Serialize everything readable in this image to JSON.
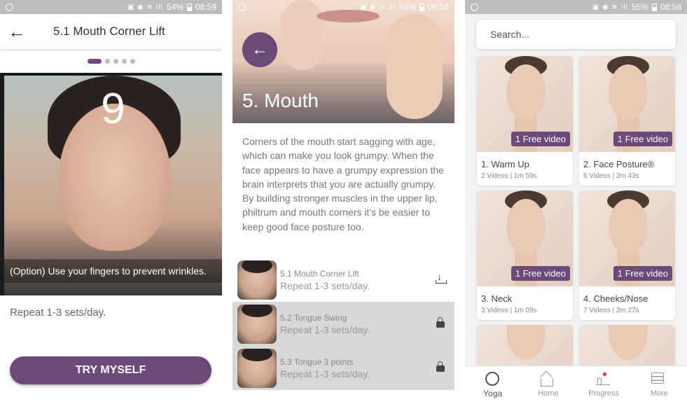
{
  "status_bars": [
    {
      "battery": "54%",
      "time": "08:59"
    },
    {
      "battery": "55%",
      "time": "08:58"
    },
    {
      "battery": "55%",
      "time": "08:58"
    }
  ],
  "screen1": {
    "title": "5.1 Mouth Corner Lift",
    "page_count": 5,
    "active_page": 1,
    "counter": "9",
    "caption": "(Option) Use your fingers to prevent wrinkles.",
    "repeat": "Repeat 1-3 sets/day.",
    "button": "TRY MYSELF"
  },
  "screen2": {
    "title": "5. Mouth",
    "description": "Corners of the mouth start sagging with age, which can make you look grumpy. When the face appears to have a grumpy expression the brain interprets that you are actually grumpy. By building stronger muscles in the upper lip, philtrum and mouth corners it's be easier to keep good face posture too.",
    "exercises": [
      {
        "name": "5.1 Mouth Corner Lift",
        "sub": "Repeat 1-3 sets/day.",
        "icon": "download-icon",
        "locked": false
      },
      {
        "name": "5.2 Tongue Swing",
        "sub": "Repeat 1-3 sets/day.",
        "icon": "lock-icon",
        "locked": true
      },
      {
        "name": "5.3 Tongue 3 points",
        "sub": "Repeat 1-3 sets/day.",
        "icon": "lock-icon",
        "locked": true
      }
    ]
  },
  "screen3": {
    "search_placeholder": "Search...",
    "cards": [
      {
        "title": "1. Warm Up",
        "sub": "2 Videos | 1m 59s",
        "badge": "1 Free video"
      },
      {
        "title": "2. Face Posture®",
        "sub": "6 Videos | 2m 43s",
        "badge": "1 Free video"
      },
      {
        "title": "3. Neck",
        "sub": "3 Videos | 1m 09s",
        "badge": "1 Free video"
      },
      {
        "title": "4.  Cheeks/Nose",
        "sub": "7 Videos | 2m 27s",
        "badge": "1 Free video"
      }
    ],
    "nav": [
      {
        "label": "Yoga",
        "icon": "yoga-face-icon",
        "active": true
      },
      {
        "label": "Home",
        "icon": "home-icon",
        "active": false
      },
      {
        "label": "Progress",
        "icon": "progress-icon",
        "active": false
      },
      {
        "label": "More",
        "icon": "menu-icon",
        "active": false
      }
    ]
  },
  "colors": {
    "accent": "#6a4a78",
    "text": "#333333",
    "muted": "#888888"
  }
}
